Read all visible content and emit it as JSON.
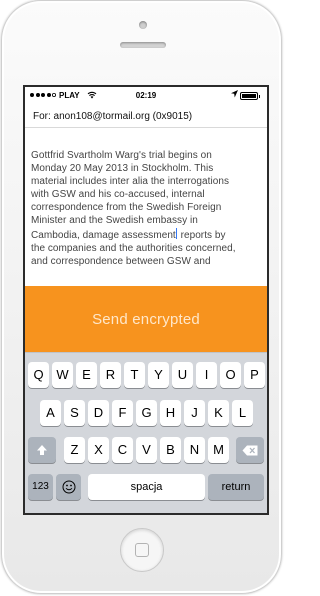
{
  "status_bar": {
    "carrier": "PLAY",
    "time": "02:19",
    "signal_bars_filled": 4,
    "signal_bars_total": 5,
    "battery_level": 1.0,
    "icons": [
      "signal-dots-icon",
      "wifi-icon",
      "location-arrow-icon",
      "battery-icon"
    ]
  },
  "compose": {
    "recipient_line": "For: anon108@tormail.org (0x9015)",
    "body_lines_before_cursor": [
      "Gottfrid Svartholm Warg's trial begins on",
      "Monday 20 May 2013 in Stockholm. This",
      "material includes inter alia the interrogations",
      "with GSW and his co-accused, internal",
      "correspondence from the Swedish Foreign",
      "Minister and the Swedish embassy in",
      "Cambodia, damage assessment"
    ],
    "cursor_line_after": " reports by",
    "body_lines_after_cursor": [
      "the companies and the authorities concerned,",
      "and correspondence between GSW and"
    ]
  },
  "send_button": {
    "label": "Send encrypted",
    "background_color": "#f7931e"
  },
  "keyboard": {
    "row1": [
      "Q",
      "W",
      "E",
      "R",
      "T",
      "Y",
      "U",
      "I",
      "O",
      "P"
    ],
    "row2": [
      "A",
      "S",
      "D",
      "F",
      "G",
      "H",
      "J",
      "K",
      "L"
    ],
    "row3": [
      "Z",
      "X",
      "C",
      "V",
      "B",
      "N",
      "M"
    ],
    "shift_icon": "shift-arrow-icon",
    "delete_icon": "backspace-icon",
    "numbers_label": "123",
    "emoji_icon": "smiley-icon",
    "space_label": "spacja",
    "return_label": "return"
  },
  "device": {
    "frame_color": "#f4f4f4"
  }
}
